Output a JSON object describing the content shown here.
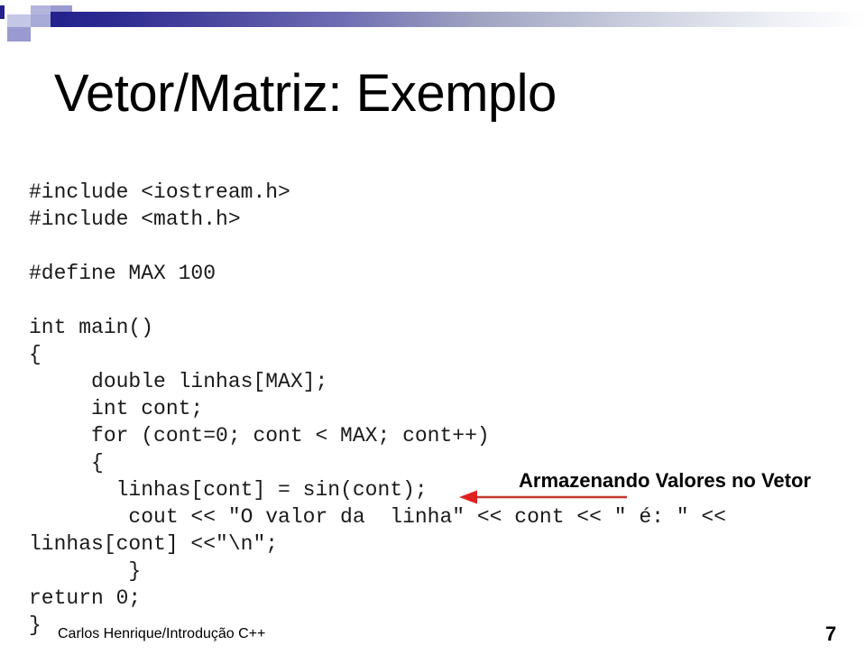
{
  "slide": {
    "title": "Vetor/Matriz: Exemplo",
    "page_number": "7",
    "footer": "Carlos Henrique/Introdução C++"
  },
  "theme": {
    "accent_dark": "#23218c",
    "accent_light": "#9a9ad0",
    "accent_pale": "#c5c7e6",
    "arrow_color": "#c0392b",
    "text_color": "#000000",
    "background": "#ffffff"
  },
  "code": {
    "language": "C++",
    "lines": [
      "#include <iostream.h>",
      "#include <math.h>",
      "",
      "#define MAX 100",
      "",
      "int main()",
      "{",
      "     double linhas[MAX];",
      "     int cont;",
      "     for (cont=0; cont < MAX; cont++)",
      "     {",
      "       linhas[cont] = sin(cont);",
      "        cout << \"O valor da  linha\" << cont << \" é: \" <<",
      "linhas[cont] <<\"\\n\";",
      "        }",
      "return 0;",
      "}"
    ]
  },
  "annotation": {
    "label": "Armazenando Valores no Vetor",
    "arrow_direction": "left",
    "points_to_line": "linhas[cont] = sin(cont);"
  }
}
